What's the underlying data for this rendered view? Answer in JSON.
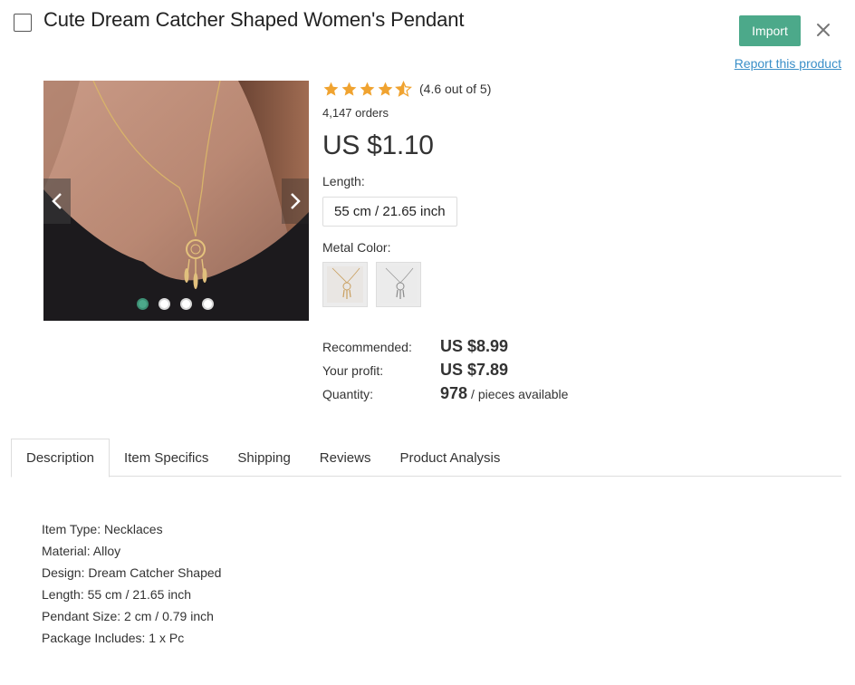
{
  "header": {
    "title": "Cute Dream Catcher Shaped Women's Pendant",
    "import_label": "Import",
    "report_label": "Report this product"
  },
  "gallery": {
    "image_count": 4,
    "active_index": 0
  },
  "product": {
    "rating": 4.6,
    "rating_text": "(4.6 out of 5)",
    "orders": "4,147 orders",
    "price": "US $1.10",
    "length_label": "Length:",
    "length_selected": "55 cm / 21.65 inch",
    "metal_color_label": "Metal Color:",
    "metal_colors": [
      "gold-pendant-swatch",
      "silver-pendant-swatch"
    ]
  },
  "stats": {
    "recommended_label": "Recommended:",
    "recommended_value": "US $8.99",
    "profit_label": "Your profit:",
    "profit_value": "US $7.89",
    "quantity_label": "Quantity:",
    "quantity_value": "978",
    "quantity_suffix": "/ pieces available"
  },
  "tabs": [
    {
      "label": "Description",
      "active": true
    },
    {
      "label": "Item Specifics",
      "active": false
    },
    {
      "label": "Shipping",
      "active": false
    },
    {
      "label": "Reviews",
      "active": false
    },
    {
      "label": "Product Analysis",
      "active": false
    }
  ],
  "description": {
    "lines": [
      "Item Type: Necklaces",
      "Material: Alloy",
      "Design: Dream Catcher Shaped",
      "Length: 55 cm / 21.65 inch",
      "Pendant Size: 2 cm / 0.79 inch",
      "Package Includes: 1 x Pc"
    ]
  },
  "colors": {
    "accent": "#4ca98a",
    "link": "#3a8fc8",
    "star": "#f0a330"
  },
  "icons": {
    "close": "close-icon",
    "prev": "chevron-left-icon",
    "next": "chevron-right-icon",
    "star": "star-icon",
    "checkbox": "checkbox-icon"
  }
}
